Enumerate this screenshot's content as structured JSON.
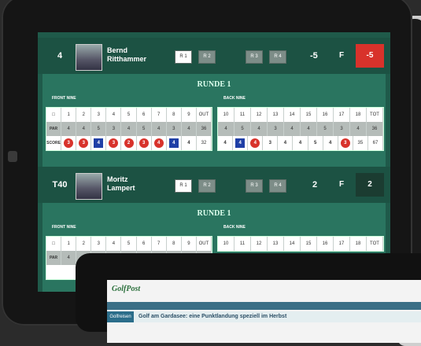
{
  "players": [
    {
      "position": "4",
      "name_first": "Bernd",
      "name_last": "Ritthammer",
      "rounds": [
        "R 1",
        "R 2",
        "R 3",
        "R 4"
      ],
      "total": "-5",
      "thru": "F",
      "score": "-5",
      "score_color": "#d8322b",
      "round_title": "RUNDE 1",
      "front_label": "FRONT NINE",
      "back_label": "BACK NINE",
      "front": {
        "holes": [
          "1",
          "2",
          "3",
          "4",
          "5",
          "6",
          "7",
          "8",
          "9",
          "OUT"
        ],
        "par": [
          "4",
          "4",
          "5",
          "3",
          "4",
          "5",
          "4",
          "3",
          "4",
          "36"
        ],
        "score": [
          "3",
          "3",
          "4",
          "3",
          "2",
          "3",
          "4",
          "4",
          "4",
          "32"
        ],
        "score_marks": [
          "red",
          "red",
          "blue",
          "red",
          "red",
          "red",
          "red",
          "blue",
          "none",
          "none"
        ]
      },
      "back": {
        "holes": [
          "10",
          "11",
          "12",
          "13",
          "14",
          "15",
          "16",
          "17",
          "18",
          "TOT"
        ],
        "par": [
          "4",
          "5",
          "4",
          "3",
          "4",
          "4",
          "5",
          "3",
          "4",
          "36"
        ],
        "score": [
          "4",
          "4",
          "4",
          "3",
          "4",
          "4",
          "5",
          "4",
          "3",
          "35"
        ],
        "score_marks": [
          "none",
          "blue",
          "red",
          "none",
          "none",
          "none",
          "none",
          "none",
          "red",
          "none"
        ],
        "total": "67"
      }
    },
    {
      "position": "T40",
      "name_first": "Moritz",
      "name_last": "Lampert",
      "rounds": [
        "R 1",
        "R 2",
        "R 3",
        "R 4"
      ],
      "total": "2",
      "thru": "F",
      "score": "2",
      "score_color": "#1b3c31",
      "round_title": "RUNDE 1",
      "front_label": "FRONT NINE",
      "back_label": "BACK NINE",
      "front": {
        "holes": [
          "1",
          "2",
          "3",
          "4",
          "5",
          "6",
          "7",
          "8",
          "9",
          "OUT"
        ],
        "par": [
          "4",
          "4",
          "5",
          "3",
          "4",
          "5",
          "4",
          "3",
          "4",
          "36"
        ]
      },
      "back": {
        "holes": [
          "10",
          "11",
          "12",
          "13",
          "14",
          "15",
          "16",
          "17",
          "18",
          "TOT"
        ]
      }
    }
  ],
  "labels": {
    "hole": "□",
    "par": "PAR",
    "score": "SCORE"
  },
  "website": {
    "logo": "GolfPost",
    "tag": "Golfreisen",
    "headline": "Golf am Gardasee: eine Punktlandung speziell im Herbst"
  }
}
